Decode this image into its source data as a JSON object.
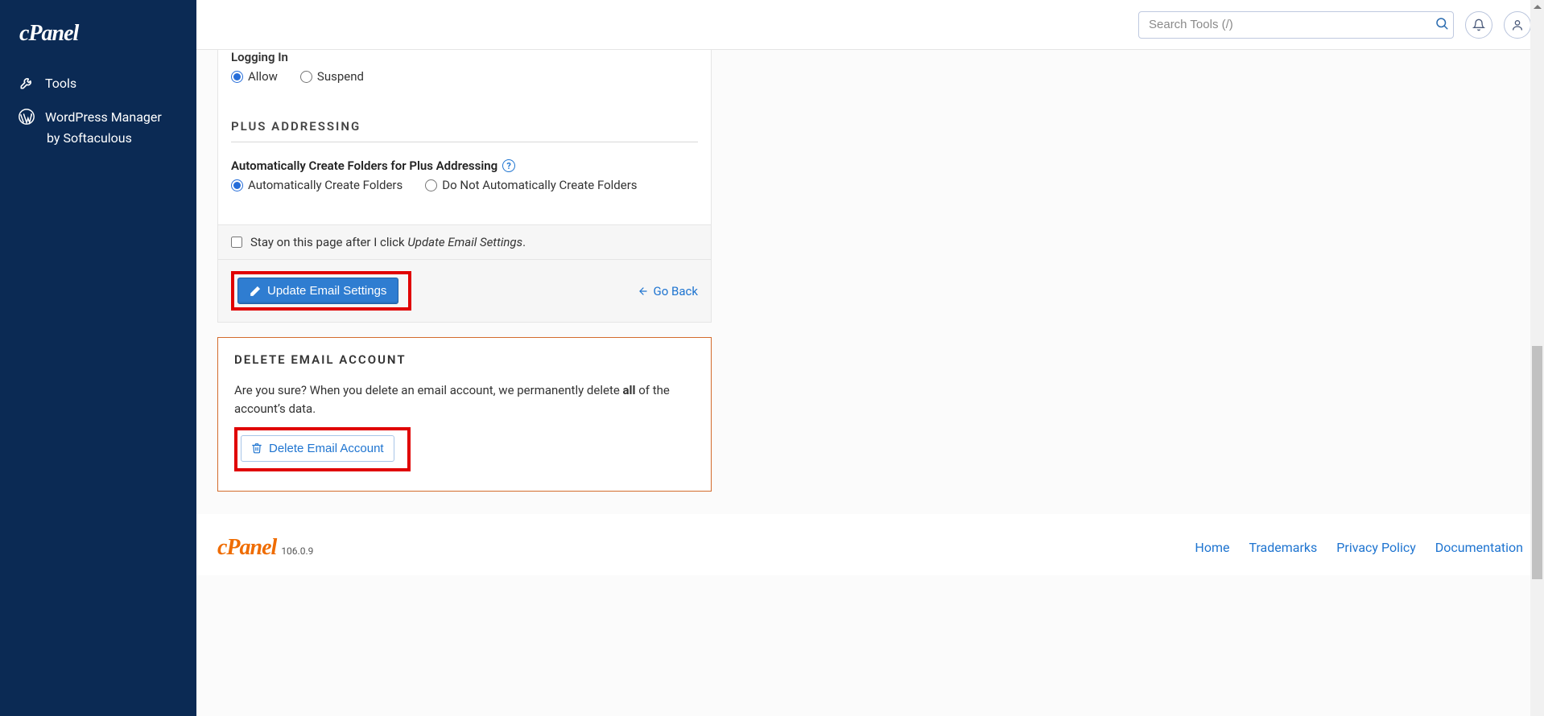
{
  "sidebar": {
    "logo": "cPanel",
    "items": [
      {
        "label": "Tools"
      },
      {
        "label": "WordPress Manager"
      }
    ],
    "wp_line2": "by Softaculous"
  },
  "topbar": {
    "search_placeholder": "Search Tools (/)"
  },
  "settings": {
    "logging_in_label": "Logging In",
    "allow_label": "Allow",
    "suspend_label": "Suspend",
    "plus_heading": "PLUS ADDRESSING",
    "auto_folders_label": "Automatically Create Folders for Plus Addressing",
    "auto_create_label": "Automatically Create Folders",
    "no_auto_create_label": "Do Not Automatically Create Folders",
    "stay_prefix": "Stay on this page after I click ",
    "stay_em": "Update Email Settings",
    "stay_suffix": ".",
    "update_btn": "Update Email Settings",
    "go_back": "Go Back"
  },
  "delete": {
    "heading": "DELETE EMAIL ACCOUNT",
    "text_before": "Are you sure? When you delete an email account, we permanently delete ",
    "text_bold": "all",
    "text_after": " of the account’s data.",
    "button": "Delete Email Account"
  },
  "footer": {
    "brand": "cPanel",
    "version": "106.0.9",
    "links": [
      "Home",
      "Trademarks",
      "Privacy Policy",
      "Documentation"
    ]
  }
}
